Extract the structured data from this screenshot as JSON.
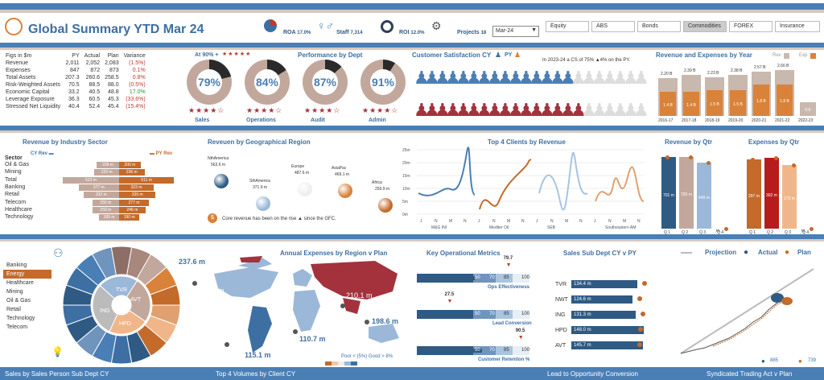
{
  "header": {
    "title": "Global Summary YTD Mar 24",
    "kpis": [
      {
        "label": "ROA",
        "value": "17.0%"
      },
      {
        "label": "Staff",
        "value": "7,314"
      },
      {
        "label": "ROI",
        "value": "12.0%"
      },
      {
        "label": "Projects",
        "value": "18"
      }
    ],
    "period": "Mar-24",
    "tabs": [
      "Equity",
      "ABS",
      "Bonds",
      "Commodities",
      "FOREX",
      "Insurance"
    ],
    "active_tab": "Commodities"
  },
  "figs": {
    "headers": [
      "Figs in $m",
      "PY",
      "Actual",
      "Plan",
      "Variance"
    ],
    "rows": [
      [
        "Revenue",
        "2,011",
        "2,052",
        "2,083",
        "(1.5%)"
      ],
      [
        "Expenses",
        "847",
        "872",
        "873",
        "0.1%"
      ],
      [
        "Total Assets",
        "207.3",
        "260.6",
        "258.5",
        "0.8%"
      ],
      [
        "Risk-Weighted Assets",
        "70.5",
        "88.5",
        "88.0",
        "(0.5%)"
      ],
      [
        "Economic Capital",
        "33.2",
        "40.5",
        "48.8",
        "17.0%"
      ],
      [
        "Leverage Exposure",
        "36.3",
        "60.5",
        "45.3",
        "(33.6%)"
      ],
      [
        "Stressed Net Liquidity",
        "40.4",
        "52.4",
        "45.4",
        "(15.4%)"
      ]
    ],
    "var_colors": [
      "#c0392b",
      "#c0392b",
      "#c0392b",
      "#c0392b",
      "#3a8a3a",
      "#c0392b",
      "#c0392b"
    ]
  },
  "perf": {
    "title": "Performance by Dept",
    "at90": "At 90% +",
    "items": [
      {
        "label": "Sales",
        "value": "79%",
        "pct": 79
      },
      {
        "label": "Operations",
        "value": "84%",
        "pct": 84
      },
      {
        "label": "Audit",
        "value": "87%",
        "pct": 87
      },
      {
        "label": "Admin",
        "value": "91%",
        "pct": 91
      }
    ]
  },
  "cs": {
    "title": "Customer Satisfaction CY",
    "legend_py": "PY",
    "note": "In 2023-24 a CS of 75% ▲4% on the PY."
  },
  "rev_exp": {
    "title": "Revenue and Expenses by Year",
    "legend": [
      "Rev",
      "Exp"
    ],
    "years": [
      "2016-17",
      "2017-18",
      "2018-19",
      "2019-20",
      "2020-21",
      "2021-22",
      "2022-23"
    ],
    "rev": [
      2.2,
      2.39,
      2.23,
      2.38,
      2.57,
      2.66,
      0
    ],
    "rev_labels": [
      "2.20 B",
      "2.39 B",
      "2.23 B",
      "2.38 B",
      "2.57 B",
      "2.66 B",
      ""
    ],
    "exp": [
      1.4,
      1.4,
      1.5,
      1.5,
      1.8,
      1.8,
      0.8
    ],
    "exp_labels": [
      "1.4 B",
      "1.4 B",
      "1.5 B",
      "1.5 B",
      "1.8 B",
      "1.8 B",
      "0.8"
    ]
  },
  "ind": {
    "title": "Revenue by Industry Sector",
    "sector_label": "Sector",
    "cy": "CY Rev",
    "py": "PY Rev",
    "sectors": [
      "Oil & Gas",
      "Mining",
      "Total",
      "Banking",
      "Retail",
      "Telecom",
      "Healthcare",
      "Technology"
    ],
    "cy_labels": [
      "209 m",
      "229 m",
      "523 m",
      "377 m",
      "332 m",
      "250 m",
      "250 m",
      "185 m"
    ],
    "py_labels": [
      "200 m",
      "236 m",
      "511 m",
      "323 m",
      "339 m",
      "277 m",
      "246 m",
      "190 m"
    ],
    "cy_vals": [
      209,
      229,
      523,
      377,
      332,
      250,
      250,
      185
    ],
    "py_vals": [
      200,
      236,
      511,
      323,
      339,
      277,
      246,
      190
    ]
  },
  "geo": {
    "title": "Reveuen by Geographical Region",
    "regions": [
      {
        "name": "NthAmerica",
        "value": "563.6 m"
      },
      {
        "name": "SthAmerica",
        "value": "371.9 m"
      },
      {
        "name": "Europe",
        "value": "487.6 m"
      },
      {
        "name": "AsiaPac",
        "value": "469.1 m"
      },
      {
        "name": "Africa",
        "value": "259.9 m"
      }
    ],
    "note": "Core revenue has been on the rise ▲ since the GFC."
  },
  "clients": {
    "title": "Top 4 Clients by Revenue",
    "yticks": [
      "25m",
      "20m",
      "15m",
      "10m",
      "5m",
      "0m"
    ],
    "groups": [
      "M&G INI",
      "Mediter Oil",
      "SEB",
      "Southeastern AM"
    ],
    "months": [
      "J",
      "N",
      "M",
      "N"
    ]
  },
  "qtr": {
    "rev_title": "Revenue by Qtr",
    "exp_title": "Expenses by Qtr",
    "quarters": [
      "Q 1",
      "Q 2",
      "Q 3",
      "Q 4"
    ],
    "rev": [
      701,
      703,
      649,
      0
    ],
    "rev_labels": [
      "701 m",
      "703 m",
      "649 m",
      "m"
    ],
    "exp": [
      297,
      302,
      273,
      0
    ],
    "exp_labels": [
      "297 m",
      "302 m",
      "273 m",
      "m"
    ]
  },
  "sp": {
    "title": "Sales by Sales Person Sub Dept CY",
    "list": [
      "Banking",
      "Energy",
      "Healthcare",
      "Mining",
      "Oil & Gas",
      "Retail",
      "Technology",
      "Telecom"
    ],
    "active": "Energy",
    "segments": [
      "TVR",
      "AVT",
      "HPD",
      "ING"
    ]
  },
  "ann": {
    "title": "Annual Expenses by Region v Plan",
    "labels": [
      "237.6 m",
      "237.6 m",
      "210.1 m",
      "198.6 m",
      "110.7 m",
      "115.1 m"
    ],
    "legend": "Poor < (5%)   Good > 8%"
  },
  "kom": {
    "title": "Key Operational Metrics",
    "items": [
      {
        "label": "Ops Effectiveness",
        "marker": "79.7",
        "a": "50",
        "b": "70",
        "c": "85",
        "d": "100",
        "pct": 79.7
      },
      {
        "label": "Lead Conversion",
        "marker": "27.5",
        "a": "50",
        "b": "70",
        "c": "85",
        "d": "100",
        "pct": 27.5
      },
      {
        "label": "Customer Retention %",
        "marker": "90.5",
        "a": "50",
        "b": "70",
        "c": "85",
        "d": "100",
        "pct": 90.5
      }
    ]
  },
  "subd": {
    "title": "Sales Sub Dept CY v PY",
    "rows": [
      {
        "name": "TVR",
        "value": "134.4 m",
        "v": 134.4
      },
      {
        "name": "NWT",
        "value": "124.6 m",
        "v": 124.6
      },
      {
        "name": "ING",
        "value": "131.3 m",
        "v": 131.3
      },
      {
        "name": "HPD",
        "value": "148.0 m",
        "v": 148
      },
      {
        "name": "AVT",
        "value": "145.7 m",
        "v": 145.7
      }
    ]
  },
  "proj": {
    "legend": [
      "Projection",
      "Actual",
      "Plan"
    ],
    "actual": "885",
    "plan": "739"
  },
  "footer": [
    "Sales by Sales Person Sub Dept CY",
    "Top 4 Volumes by Client CY",
    "Lead to Opportunity Conversion",
    "Syndicated Trading Act v Plan"
  ]
}
